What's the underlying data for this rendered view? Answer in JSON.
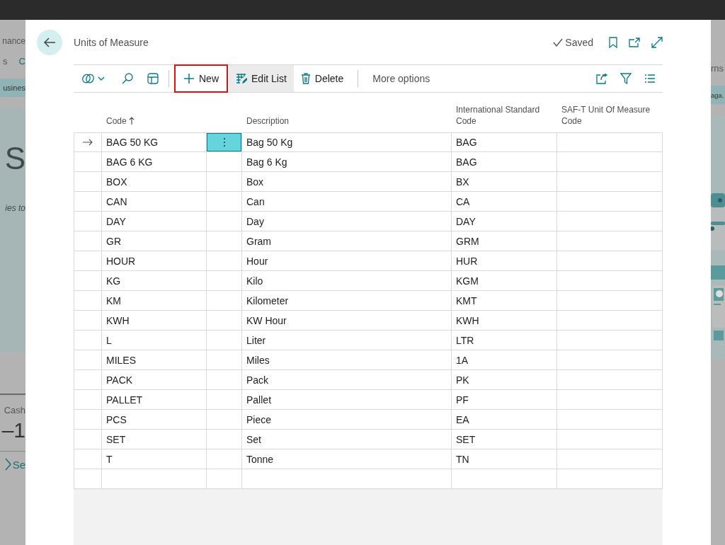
{
  "background_page": {
    "left_fragments": [
      {
        "kind": "title",
        "text": "nance"
      },
      {
        "kind": "nav",
        "texts": [
          "s",
          "C"
        ]
      },
      {
        "kind": "band",
        "text": "usines"
      },
      {
        "kind": "hero",
        "text": "S",
        "subtitle": "ies to"
      },
      {
        "kind": "tile",
        "label": "Cash",
        "value": "–1",
        "link": "Se"
      }
    ],
    "right_fragments": [
      {
        "kind": "nav",
        "text": "rns"
      },
      {
        "kind": "band",
        "text": "aga."
      }
    ]
  },
  "dialog": {
    "title": "Units of Measure",
    "status": "Saved",
    "toolbar": {
      "actions": [
        {
          "label": "New",
          "outlined": true,
          "hovered": false
        },
        {
          "label": "Edit List",
          "outlined": false,
          "hovered": true
        },
        {
          "label": "Delete",
          "outlined": false,
          "hovered": false
        }
      ],
      "more": "More options"
    },
    "table": {
      "columns": [
        {
          "label": "Code",
          "sorted": true
        },
        {
          "label": "Description",
          "sorted": false
        },
        {
          "label": "International Standard Code",
          "sorted": false
        },
        {
          "label": "SAF-T Unit Of Measure Code",
          "sorted": false
        }
      ],
      "rows": [
        {
          "code": "BAG 50 KG",
          "description": "Bag 50 Kg",
          "international_code": "BAG",
          "selected": true
        },
        {
          "code": "BAG 6 KG",
          "description": "Bag 6 Kg",
          "international_code": "BAG",
          "selected": false
        },
        {
          "code": "BOX",
          "description": "Box",
          "international_code": "BX",
          "selected": false
        },
        {
          "code": "CAN",
          "description": "Can",
          "international_code": "CA",
          "selected": false
        },
        {
          "code": "DAY",
          "description": "Day",
          "international_code": "DAY",
          "selected": false
        },
        {
          "code": "GR",
          "description": "Gram",
          "international_code": "GRM",
          "selected": false
        },
        {
          "code": "HOUR",
          "description": "Hour",
          "international_code": "HUR",
          "selected": false
        },
        {
          "code": "KG",
          "description": "Kilo",
          "international_code": "KGM",
          "selected": false
        },
        {
          "code": "KM",
          "description": "Kilometer",
          "international_code": "KMT",
          "selected": false
        },
        {
          "code": "KWH",
          "description": "KW Hour",
          "international_code": "KWH",
          "selected": false
        },
        {
          "code": "L",
          "description": "Liter",
          "international_code": "LTR",
          "selected": false
        },
        {
          "code": "MILES",
          "description": "Miles",
          "international_code": "1A",
          "selected": false
        },
        {
          "code": "PACK",
          "description": "Pack",
          "international_code": "PK",
          "selected": false
        },
        {
          "code": "PALLET",
          "description": "Pallet",
          "international_code": "PF",
          "selected": false
        },
        {
          "code": "PCS",
          "description": "Piece",
          "international_code": "EA",
          "selected": false
        },
        {
          "code": "SET",
          "description": "Set",
          "international_code": "SET",
          "selected": false
        },
        {
          "code": "T",
          "description": "Tonne",
          "international_code": "TN",
          "selected": false
        }
      ]
    }
  }
}
